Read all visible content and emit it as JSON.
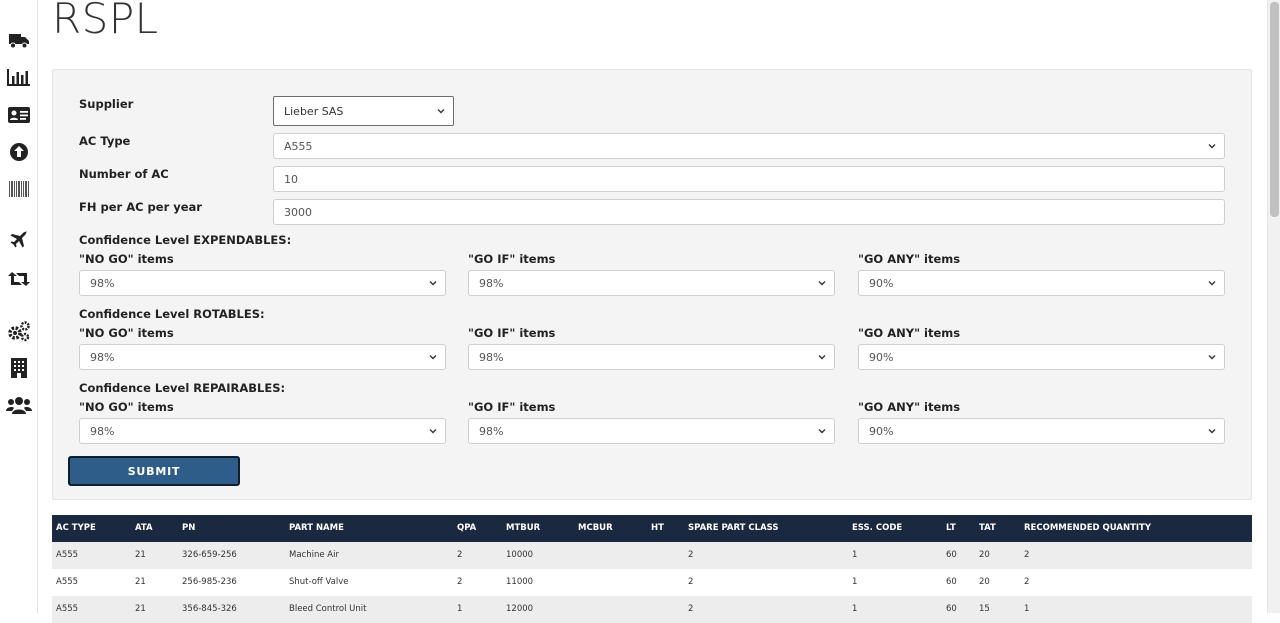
{
  "sidebar": {
    "items": [
      {
        "icon": "truck-icon"
      },
      {
        "icon": "bar-chart-icon"
      },
      {
        "icon": "id-card-icon"
      },
      {
        "icon": "upload-circle-icon"
      },
      {
        "icon": "barcode-icon"
      },
      {
        "icon": "plane-icon"
      },
      {
        "icon": "retweet-icon"
      },
      {
        "icon": "cogs-icon"
      },
      {
        "icon": "building-icon"
      },
      {
        "icon": "users-icon"
      }
    ]
  },
  "page": {
    "title": "RSPL"
  },
  "form": {
    "supplier": {
      "label": "Supplier",
      "value": "Lieber SAS"
    },
    "ac_type": {
      "label": "AC Type",
      "value": "A555"
    },
    "number_of_ac": {
      "label": "Number of AC",
      "value": "10"
    },
    "fh_per_ac": {
      "label": "FH per AC per year",
      "value": "3000"
    },
    "expendables": {
      "heading": "Confidence Level EXPENDABLES:",
      "no_go": {
        "label": "\"NO GO\" items",
        "value": "98%"
      },
      "go_if": {
        "label": "\"GO IF\" items",
        "value": "98%"
      },
      "go_any": {
        "label": "\"GO ANY\" items",
        "value": "90%"
      }
    },
    "rotables": {
      "heading": "Confidence Level ROTABLES:",
      "no_go": {
        "label": "\"NO GO\" items",
        "value": "98%"
      },
      "go_if": {
        "label": "\"GO IF\" items",
        "value": "98%"
      },
      "go_any": {
        "label": "\"GO ANY\" items",
        "value": "90%"
      }
    },
    "repairables": {
      "heading": "Confidence Level REPAIRABLES:",
      "no_go": {
        "label": "\"NO GO\" items",
        "value": "98%"
      },
      "go_if": {
        "label": "\"GO IF\" items",
        "value": "98%"
      },
      "go_any": {
        "label": "\"GO ANY\" items",
        "value": "90%"
      }
    },
    "submit_label": "SUBMIT"
  },
  "table": {
    "headers": [
      "AC TYPE",
      "ATA",
      "PN",
      "PART NAME",
      "QPA",
      "MTBUR",
      "MCBUR",
      "HT",
      "SPARE PART CLASS",
      "ESS. CODE",
      "LT",
      "TAT",
      "RECOMMENDED QUANTITY"
    ],
    "rows": [
      [
        "A555",
        "21",
        "326-659-256",
        "Machine Air",
        "2",
        "10000",
        "",
        "",
        "2",
        "1",
        "60",
        "20",
        "2"
      ],
      [
        "A555",
        "21",
        "256-985-236",
        "Shut-off Valve",
        "2",
        "11000",
        "",
        "",
        "2",
        "1",
        "60",
        "20",
        "2"
      ],
      [
        "A555",
        "21",
        "356-845-326",
        "Bleed Control Unit",
        "1",
        "12000",
        "",
        "",
        "2",
        "1",
        "60",
        "15",
        "1"
      ]
    ]
  },
  "colors": {
    "table_header_bg": "#1b2940",
    "submit_bg": "#2f5d8a",
    "panel_bg": "#f4f4f4"
  }
}
